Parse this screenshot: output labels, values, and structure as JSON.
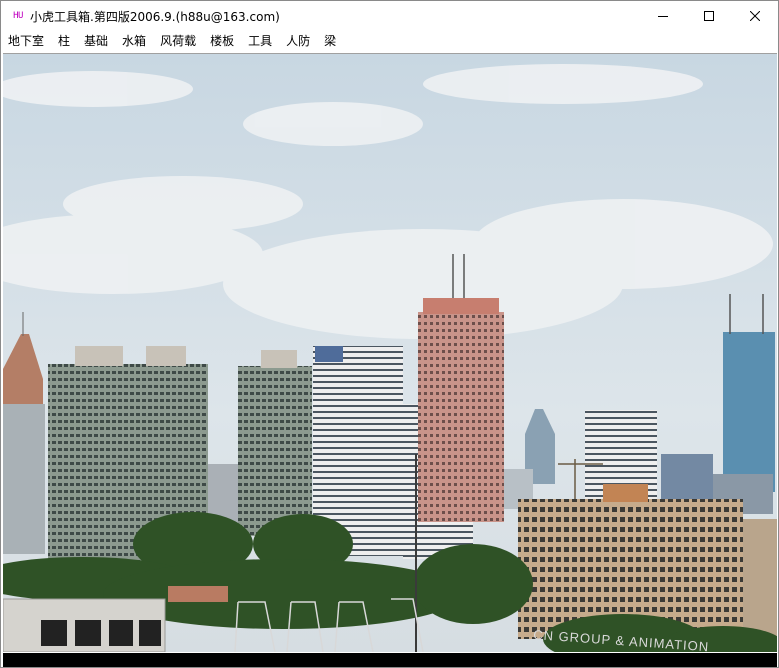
{
  "window": {
    "app_icon_text": "HU",
    "title": "小虎工具箱.第四版2006.9.(h88u@163.com)",
    "minimize_icon": "minimize-icon",
    "maximize_icon": "maximize-icon",
    "close_icon": "close-icon"
  },
  "menu": {
    "items": [
      "地下室",
      "柱",
      "基础",
      "水箱",
      "风荷载",
      "楼板",
      "工具",
      "人防",
      "梁"
    ]
  },
  "content": {
    "image_kind": "city skyline photograph",
    "sign_text": "CN GROUP & ANIMATION"
  },
  "colors": {
    "sky": "#cfdbe3",
    "app_icon": "#c000c0"
  }
}
